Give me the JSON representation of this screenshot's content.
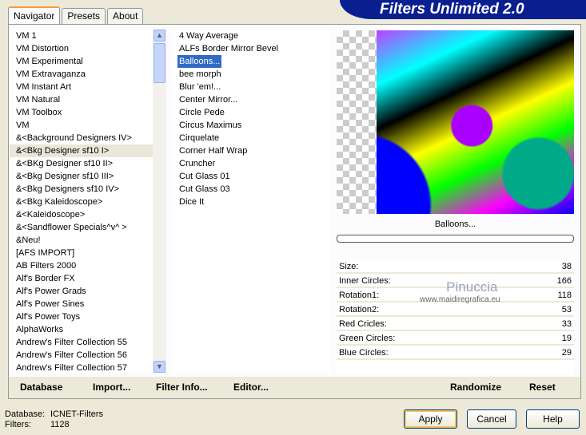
{
  "title": "Filters Unlimited 2.0",
  "tabs": [
    "Navigator",
    "Presets",
    "About"
  ],
  "categories": [
    "VM 1",
    "VM Distortion",
    "VM Experimental",
    "VM Extravaganza",
    "VM Instant Art",
    "VM Natural",
    "VM Toolbox",
    "VM",
    "&<Background Designers IV>",
    "&<Bkg Designer sf10 I>",
    "&<BKg Designer sf10 II>",
    "&<Bkg Designer sf10 III>",
    "&<Bkg Designers sf10 IV>",
    "&<Bkg Kaleidoscope>",
    "&<Kaleidoscope>",
    "&<Sandflower Specials^v^ >",
    "&Neu!",
    "[AFS IMPORT]",
    "AB Filters 2000",
    "Alf's Border FX",
    "Alf's Power Grads",
    "Alf's Power Sines",
    "Alf's Power Toys",
    "AlphaWorks",
    "Andrew's Filter Collection 55",
    "Andrew's Filter Collection 56",
    "Andrew's Filter Collection 57"
  ],
  "selected_category": "&<Bkg Designer sf10 I>",
  "filters": [
    "4 Way Average",
    "ALFs Border Mirror Bevel",
    "Balloons...",
    "bee morph",
    "Blur 'em!...",
    "Center Mirror...",
    "Circle Pede",
    "Circus Maximus",
    "Cirquelate",
    "Corner Half Wrap",
    "Cruncher",
    "Cut Glass 01",
    "Cut Glass 03",
    "Dice It"
  ],
  "selected_filter": "Balloons...",
  "filter_name": "Balloons...",
  "params": [
    {
      "label": "Size:",
      "value": "38"
    },
    {
      "label": "Inner Circles:",
      "value": "166"
    },
    {
      "label": "Rotation1:",
      "value": "118"
    },
    {
      "label": "Rotation2:",
      "value": "53"
    },
    {
      "label": "Red Cricles:",
      "value": "33"
    },
    {
      "label": "Green Circles:",
      "value": "19"
    },
    {
      "label": "Blue Circles:",
      "value": "29"
    }
  ],
  "watermark": {
    "name": "Pinuccia",
    "url": "www.maidiregrafica.eu"
  },
  "bottom": {
    "database": "Database",
    "import": "Import...",
    "filter_info": "Filter Info...",
    "editor": "Editor...",
    "randomize": "Randomize",
    "reset": "Reset"
  },
  "status": {
    "db_label": "Database:",
    "db_value": "ICNET-Filters",
    "filters_label": "Filters:",
    "filters_value": "1128"
  },
  "buttons": {
    "apply": "Apply",
    "cancel": "Cancel",
    "help": "Help"
  }
}
